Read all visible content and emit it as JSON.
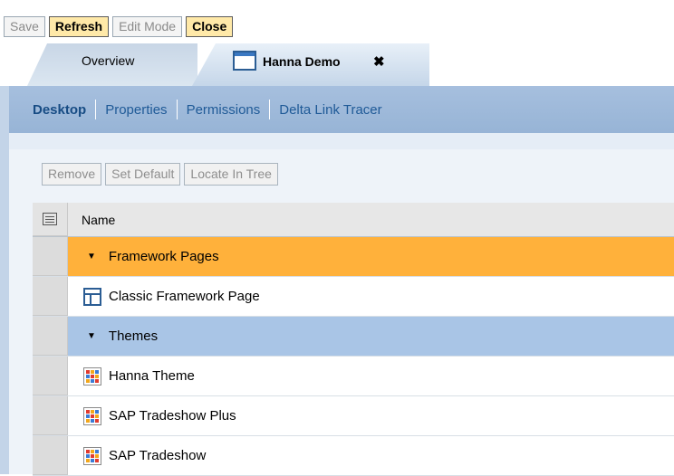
{
  "toolbar": {
    "save": "Save",
    "refresh": "Refresh",
    "edit_mode": "Edit Mode",
    "close": "Close"
  },
  "tabs": [
    {
      "label": "Overview",
      "active": false
    },
    {
      "label": "Hanna Demo",
      "active": true,
      "icon": "window-icon",
      "close_glyph": "✖"
    }
  ],
  "subnav": {
    "items": [
      {
        "label": "Desktop",
        "current": true
      },
      {
        "label": "Properties",
        "current": false
      },
      {
        "label": "Permissions",
        "current": false
      },
      {
        "label": "Delta Link Tracer",
        "current": false
      }
    ]
  },
  "table_toolbar": {
    "remove": "Remove",
    "set_default": "Set Default",
    "locate_in_tree": "Locate In Tree"
  },
  "table": {
    "header": {
      "name": "Name"
    },
    "rows": [
      {
        "type": "group",
        "label": "Framework Pages",
        "color": "#ffb13b"
      },
      {
        "type": "item",
        "label": "Classic Framework Page",
        "icon": "framework-page-icon"
      },
      {
        "type": "group",
        "label": "Themes",
        "color": "#a9c5e6"
      },
      {
        "type": "item",
        "label": "Hanna Theme",
        "icon": "theme-icon"
      },
      {
        "type": "item",
        "label": "SAP Tradeshow Plus",
        "icon": "theme-icon"
      },
      {
        "type": "item",
        "label": "SAP Tradeshow",
        "icon": "theme-icon"
      }
    ]
  },
  "colors": {
    "accent_orange": "#ffb13b",
    "nav_blue": "#97b4d6",
    "link_blue": "#1f5a97"
  }
}
